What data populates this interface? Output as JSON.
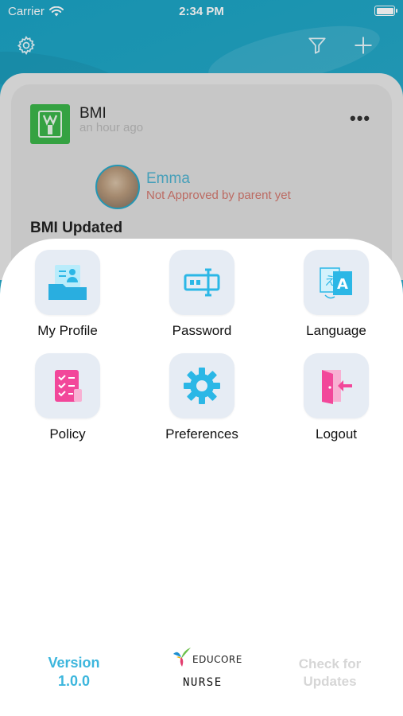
{
  "status_bar": {
    "carrier": "Carrier",
    "time": "2:34 PM"
  },
  "nav": {
    "settings_icon": "gear-icon",
    "filter_icon": "filter-icon",
    "add_icon": "plus-icon"
  },
  "post": {
    "title": "BMI",
    "time": "an hour ago",
    "child_name": "Emma",
    "child_status": "Not Approved by parent yet",
    "heading": "BMI Updated"
  },
  "menu": {
    "items": [
      {
        "label": "My Profile",
        "icon": "profile-card-icon"
      },
      {
        "label": "Password",
        "icon": "password-icon"
      },
      {
        "label": "Language",
        "icon": "language-icon"
      },
      {
        "label": "Policy",
        "icon": "policy-checklist-icon"
      },
      {
        "label": "Preferences",
        "icon": "gear-icon"
      },
      {
        "label": "Logout",
        "icon": "logout-door-icon"
      }
    ]
  },
  "footer": {
    "version_line1": "Version",
    "version_line2": "1.0.0",
    "check_line1": "Check for",
    "check_line2": "Updates",
    "logo_brand": "EDUCORE",
    "logo_sub": "NURSE"
  },
  "colors": {
    "accent": "#3cb6dd",
    "header": "#2aa8c8",
    "status_red": "#d2776e",
    "icon_tile": "#e6ecf4"
  }
}
